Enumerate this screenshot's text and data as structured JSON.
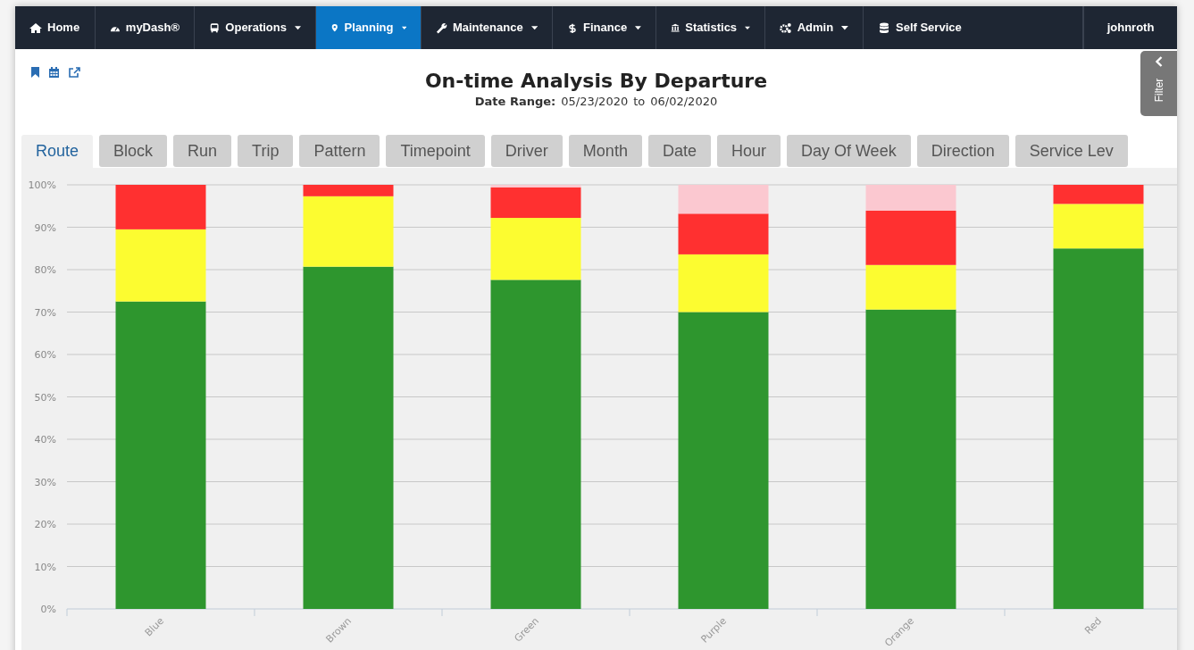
{
  "nav": {
    "items": [
      {
        "label": "Home",
        "dropdown": false,
        "selected": false
      },
      {
        "label": "myDash®",
        "dropdown": false,
        "selected": false
      },
      {
        "label": "Operations",
        "dropdown": true,
        "selected": false
      },
      {
        "label": "Planning",
        "dropdown": true,
        "selected": true
      },
      {
        "label": "Maintenance",
        "dropdown": true,
        "selected": false
      },
      {
        "label": "Finance",
        "dropdown": true,
        "selected": false
      },
      {
        "label": "Statistics",
        "dropdown": true,
        "selected": false
      },
      {
        "label": "Admin",
        "dropdown": true,
        "selected": false
      },
      {
        "label": "Self Service",
        "dropdown": false,
        "selected": false
      }
    ],
    "user": "johnroth"
  },
  "title": "On-time Analysis By Departure",
  "date_range": {
    "label": "Date Range:",
    "from": "05/23/2020",
    "separator": "to",
    "to": "06/02/2020"
  },
  "filter_tab": {
    "label": "Filter"
  },
  "tabs": [
    {
      "label": "Route",
      "selected": true
    },
    {
      "label": "Block",
      "selected": false
    },
    {
      "label": "Run",
      "selected": false
    },
    {
      "label": "Trip",
      "selected": false
    },
    {
      "label": "Pattern",
      "selected": false
    },
    {
      "label": "Timepoint",
      "selected": false
    },
    {
      "label": "Driver",
      "selected": false
    },
    {
      "label": "Month",
      "selected": false
    },
    {
      "label": "Date",
      "selected": false
    },
    {
      "label": "Hour",
      "selected": false
    },
    {
      "label": "Day Of Week",
      "selected": false
    },
    {
      "label": "Direction",
      "selected": false
    },
    {
      "label": "Service Lev",
      "selected": false
    }
  ],
  "chart_data": {
    "type": "bar",
    "stacked": true,
    "grid": true,
    "categories": [
      "Blue",
      "Brown",
      "Green",
      "Purple",
      "Orange",
      "Red"
    ],
    "series": [
      {
        "color": "#2e962e",
        "values": [
          72.5,
          80.7,
          77.6,
          70,
          70.6,
          85
        ]
      },
      {
        "color": "#fcfc30",
        "values": [
          17,
          16.6,
          14.6,
          13.6,
          10.5,
          10.5
        ]
      },
      {
        "color": "#ff3030",
        "values": [
          10.5,
          2.7,
          7.2,
          9.6,
          12.8,
          4.5
        ]
      },
      {
        "color": "#fbc8d0",
        "values": [
          0,
          0,
          0.6,
          6.8,
          6.1,
          0
        ]
      }
    ],
    "ylim": [
      0,
      100
    ],
    "yticks": [
      {
        "value": 0,
        "label": "0%"
      },
      {
        "value": 10,
        "label": "10%"
      },
      {
        "value": 20,
        "label": "20%"
      },
      {
        "value": 30,
        "label": "30%"
      },
      {
        "value": 40,
        "label": "40%"
      },
      {
        "value": 50,
        "label": "50%"
      },
      {
        "value": 60,
        "label": "60%"
      },
      {
        "value": 70,
        "label": "70%"
      },
      {
        "value": 80,
        "label": "80%"
      },
      {
        "value": 90,
        "label": "90%"
      },
      {
        "value": 100,
        "label": "100%"
      }
    ]
  }
}
